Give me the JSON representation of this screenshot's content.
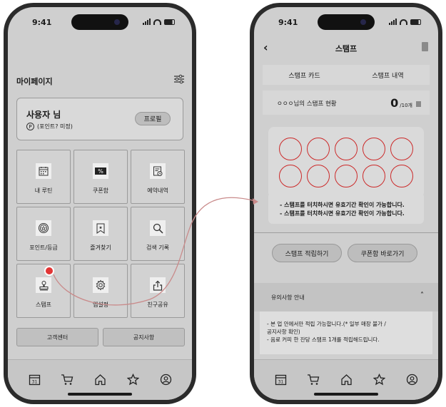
{
  "status_bar": {
    "time": "9:41"
  },
  "left_screen": {
    "title": "마이페이지",
    "profile": {
      "name": "사용자 님",
      "points_icon": "P",
      "points": "(포인트? 미정)",
      "profile_button": "프로필"
    },
    "grid": [
      {
        "icon": "calendar-icon",
        "label": "내 루틴"
      },
      {
        "icon": "coupon-icon",
        "label": "쿠폰함"
      },
      {
        "icon": "reservation-icon",
        "label": "예약내역"
      },
      {
        "icon": "badge-icon",
        "label": "포인트/등급"
      },
      {
        "icon": "bookmark-icon",
        "label": "즐겨찾기"
      },
      {
        "icon": "search-icon",
        "label": "검색 기록"
      },
      {
        "icon": "stamp-icon",
        "label": "스탬프"
      },
      {
        "icon": "gear-icon",
        "label": "앱설정"
      },
      {
        "icon": "share-icon",
        "label": "친구공유"
      }
    ],
    "buttons": {
      "customer_center": "고객센터",
      "notice": "공지사항"
    },
    "coupon_glyph": "%",
    "calendar_day": "31"
  },
  "right_screen": {
    "title": "스탬프",
    "tabs": [
      "스탬프 카드",
      "스탬프 내역"
    ],
    "status_label": "ㅇㅇㅇ님의 스탬프 현황",
    "count": "0",
    "count_total": "/10개",
    "stamp_slots": 10,
    "notice_lines": [
      "- 스탬프를 터치하시면 유효기간 확인이 가능합니다.",
      "- 스탬프를 터치하시면 유효기간 확인이 가능합니다."
    ],
    "buttons": {
      "collect": "스탬프 적립하기",
      "go_coupons": "쿠폰함 바로가기"
    },
    "caution_title": "유의사항 안내",
    "caution_lines": [
      "- 본 업 안에서만 적립 가능합니다.(* 일부 매장 불가 /",
      "  공지사항 확인)",
      "- 음료 커피 한 잔당 스탬프 1개를 적립해드립니다."
    ]
  },
  "colors": {
    "stamp_outline": "#cc2a2a",
    "connector_arrow": "#c98a8a",
    "marker": "#e23636"
  }
}
